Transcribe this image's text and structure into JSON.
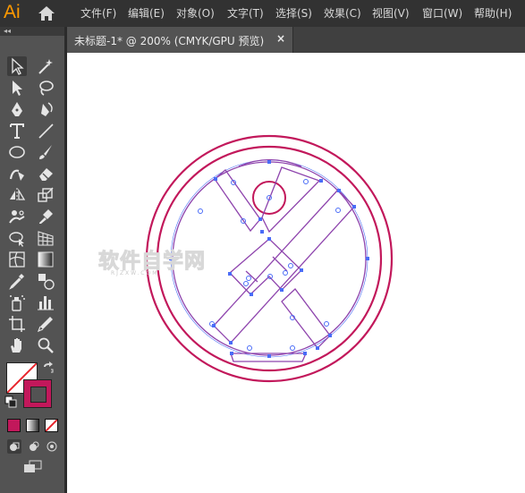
{
  "app": {
    "logo_text": "Ai"
  },
  "menu": {
    "items": [
      "文件(F)",
      "编辑(E)",
      "对象(O)",
      "文字(T)",
      "选择(S)",
      "效果(C)",
      "视图(V)",
      "窗口(W)",
      "帮助(H)"
    ]
  },
  "panel": {
    "collapse_label": "◂◂"
  },
  "document_tab": {
    "title": "未标题-1* @ 200% (CMYK/GPU 预览)",
    "close_label": "×"
  },
  "watermark": {
    "text": "软件自学网",
    "subtext": "RJZXW.COM"
  },
  "colors": {
    "menubar_bg": "#323232",
    "toolbar_bg": "#535353",
    "tabbar_bg": "#404040",
    "canvas_bg": "#ffffff",
    "stroke_color": "#c2185b",
    "path_color": "#8e44ad",
    "anchor_color": "#4a6cf7",
    "logo_color": "#ff9a00"
  },
  "tools": [
    [
      "selection-tool-icon",
      "magic-wand-tool-icon"
    ],
    [
      "direct-selection-tool-icon",
      "lasso-tool-icon"
    ],
    [
      "pen-tool-icon",
      "curvature-tool-icon"
    ],
    [
      "type-tool-icon",
      "line-segment-tool-icon"
    ],
    [
      "ellipse-tool-icon",
      "paintbrush-tool-icon"
    ],
    [
      "shaper-tool-icon",
      "eraser-tool-icon"
    ],
    [
      "reflect-tool-icon",
      "scale-tool-icon"
    ],
    [
      "puppet-warp-tool-icon",
      "free-transform-tool-icon"
    ],
    [
      "shape-builder-tool-icon",
      "perspective-grid-tool-icon"
    ],
    [
      "mesh-tool-icon",
      "gradient-tool-icon"
    ],
    [
      "eyedropper-tool-icon",
      "blend-tool-icon"
    ],
    [
      "symbol-sprayer-tool-icon",
      "column-graph-tool-icon"
    ],
    [
      "artboard-tool-icon",
      "slice-tool-icon"
    ],
    [
      "hand-tool-icon",
      "zoom-tool-icon"
    ]
  ]
}
